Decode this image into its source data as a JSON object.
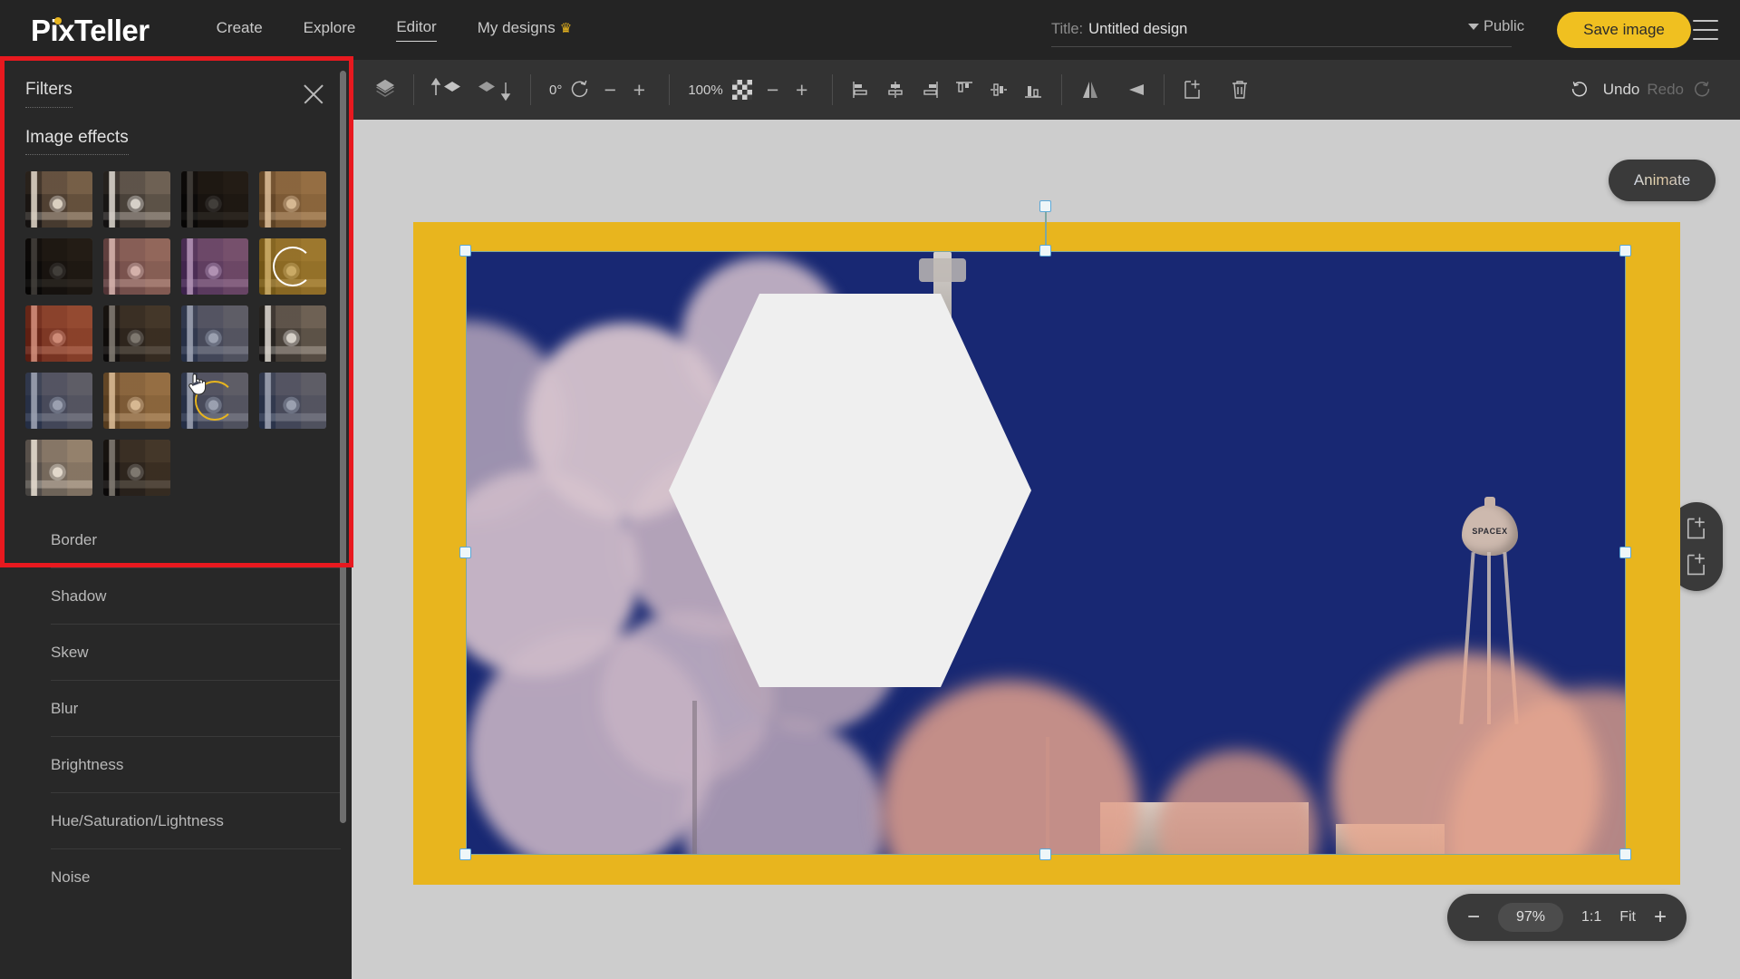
{
  "header": {
    "logo": "PixTeller",
    "logo_prefix": "P",
    "logo_mid": "ix",
    "logo_suffix": "Teller",
    "nav": [
      {
        "label": "Create",
        "active": false
      },
      {
        "label": "Explore",
        "active": false
      },
      {
        "label": "Editor",
        "active": true
      },
      {
        "label": "My designs",
        "active": false,
        "badge": "♛"
      }
    ],
    "title_label": "Title:",
    "title_value": "Untitled design",
    "title_placeholder": "Untitled design",
    "visibility": "Public",
    "save_label": "Save image",
    "menu_icon": "hamburger-icon"
  },
  "left_panel": {
    "title": "Filters",
    "close_icon": "close-icon",
    "section_title": "Image effects",
    "filters": [
      {
        "id": "original",
        "style": "ov-none"
      },
      {
        "id": "grayscale",
        "style": "ov-gray"
      },
      {
        "id": "vivid-red",
        "style": "ov-hi"
      },
      {
        "id": "warm",
        "style": "ov-warm"
      },
      {
        "id": "high-contrast",
        "style": "ov-hi"
      },
      {
        "id": "sepia-pink",
        "style": "ov-pink"
      },
      {
        "id": "purple",
        "style": "ov-purple"
      },
      {
        "id": "gold",
        "style": "ov-gold",
        "loading": true,
        "spinner": "white"
      },
      {
        "id": "red-tint",
        "style": "ov-red"
      },
      {
        "id": "dark",
        "style": "ov-dark"
      },
      {
        "id": "cool-mute",
        "style": "ov-cool"
      },
      {
        "id": "silver",
        "style": "ov-gray"
      },
      {
        "id": "cold-blue",
        "style": "ov-cool"
      },
      {
        "id": "amber",
        "style": "ov-warm"
      },
      {
        "id": "applying",
        "style": "ov-cool",
        "loading": true,
        "spinner": "gold",
        "cursor": true
      },
      {
        "id": "steel",
        "style": "ov-cool"
      },
      {
        "id": "neutral",
        "style": "ov-none"
      },
      {
        "id": "faded",
        "style": "ov-bright"
      },
      {
        "id": "contrast-warm",
        "style": "ov-dark"
      }
    ],
    "menu_items": [
      {
        "label": "Border"
      },
      {
        "label": "Shadow"
      },
      {
        "label": "Skew"
      },
      {
        "label": "Blur"
      },
      {
        "label": "Brightness"
      },
      {
        "label": "Hue/Saturation/Lightness"
      },
      {
        "label": "Noise"
      }
    ],
    "highlight_color": "#e8191f"
  },
  "toolbar": {
    "layers_icon": "layers-icon",
    "bring_forward_icon": "bring-forward-icon",
    "send_backward_icon": "send-backward-icon",
    "rotation_value": "0°",
    "rotation_icon": "rotate-icon",
    "rotation_minus": "−",
    "rotation_plus": "+",
    "opacity_value": "100%",
    "opacity_icon": "checkerboard-icon",
    "opacity_minus": "−",
    "opacity_plus": "+",
    "align": [
      "align-left-icon",
      "align-center-horizontal-icon",
      "align-right-icon",
      "align-top-icon",
      "align-middle-vertical-icon",
      "align-bottom-icon"
    ],
    "flip_horizontal_icon": "flip-horizontal-icon",
    "flip_vertical_icon": "flip-vertical-icon",
    "duplicate_icon": "duplicate-icon",
    "delete_icon": "trash-icon",
    "undo_label": "Undo",
    "redo_label": "Redo",
    "undo_icon": "undo-arrow-icon",
    "redo_icon": "redo-arrow-icon"
  },
  "canvas": {
    "animate_label": "Animate",
    "add_page_icon": "add-page-icon",
    "duplicate_page_icon": "duplicate-page-icon",
    "frame_color": "#e8b51e",
    "image_bg_color": "#16236e",
    "shape": "hexagon",
    "shape_color": "#efefef",
    "photo_caption": "SPACEX",
    "selection_handle_color": "#5ba8d8"
  },
  "zoom_controls": {
    "minus": "−",
    "percent": "97%",
    "actual_size": "1:1",
    "fit": "Fit",
    "plus": "+"
  }
}
